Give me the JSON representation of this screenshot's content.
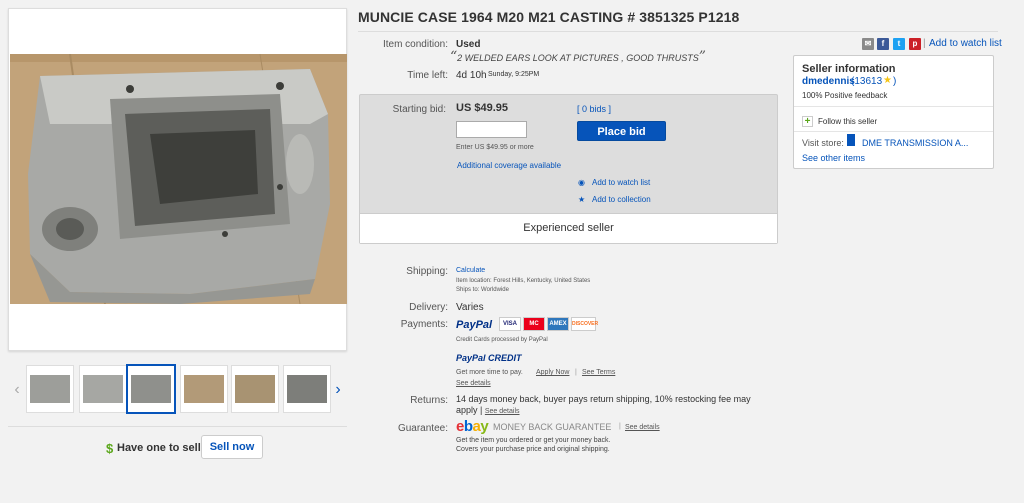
{
  "title": "MUNCIE CASE 1964 M20 M21 CASTING # 3851325 P1218",
  "condition": {
    "label": "Item condition:",
    "value": "Used",
    "description": "2 WELDED EARS LOOK AT PICTURES , GOOD THRUSTS"
  },
  "time_left": {
    "label": "Time left:",
    "value": "4d 10h",
    "detail": "Sunday, 9:25PM"
  },
  "bid": {
    "label": "Starting bid:",
    "price": "US $49.95",
    "bids_link": "[ 0 bids ]",
    "input_placeholder": "",
    "hint": "Enter US $49.95 or more",
    "coverage": "Additional coverage available",
    "place_bid": "Place bid",
    "watch": "Add to watch list",
    "collection": "Add to collection",
    "experienced": "Experienced seller"
  },
  "share": {
    "watch_link": "Add to watch list",
    "separator": "|"
  },
  "seller": {
    "heading": "Seller information",
    "name": "dmedennis",
    "feedback_count": "(13613",
    "feedback_close": ")",
    "positive": "100% Positive feedback",
    "follow": "Follow this seller",
    "visit_label": "Visit store:",
    "store_name": "DME TRANSMISSION A...",
    "see_other": "See other items"
  },
  "shipping": {
    "label": "Shipping:",
    "calculate": "Calculate",
    "location": "Item location:  Forest Hills, Kentucky, United States",
    "ships_to": "Ships to:  Worldwide"
  },
  "delivery": {
    "label": "Delivery:",
    "value": "Varies"
  },
  "payments": {
    "label": "Payments:",
    "paypal": "PayPal",
    "cards": [
      "VISA",
      "MC",
      "AMEX",
      "DISCOVER"
    ],
    "processed": "Credit Cards processed by PayPal",
    "credit_logo": "PayPal CREDIT",
    "credit_text": "Get more time to pay.",
    "apply_now": "Apply Now",
    "see_terms": "See Terms",
    "see_details": "See details"
  },
  "returns": {
    "label": "Returns:",
    "text": "14 days money back, buyer pays return shipping, 10% restocking fee may apply |",
    "see_details": "See details"
  },
  "guarantee": {
    "label": "Guarantee:",
    "ebay": "ebay",
    "mbg": "MONEY BACK GUARANTEE",
    "see_details": "See details",
    "line1": "Get the item you ordered or get your money back.",
    "line2": "Covers your purchase price and original shipping."
  },
  "sell": {
    "text": "Have one to sell?",
    "button": "Sell now",
    "dollar": "$"
  },
  "colors": {
    "link": "#0654ba",
    "button": "#0654ba",
    "star": "#f5c518",
    "green": "#5ba71b"
  }
}
